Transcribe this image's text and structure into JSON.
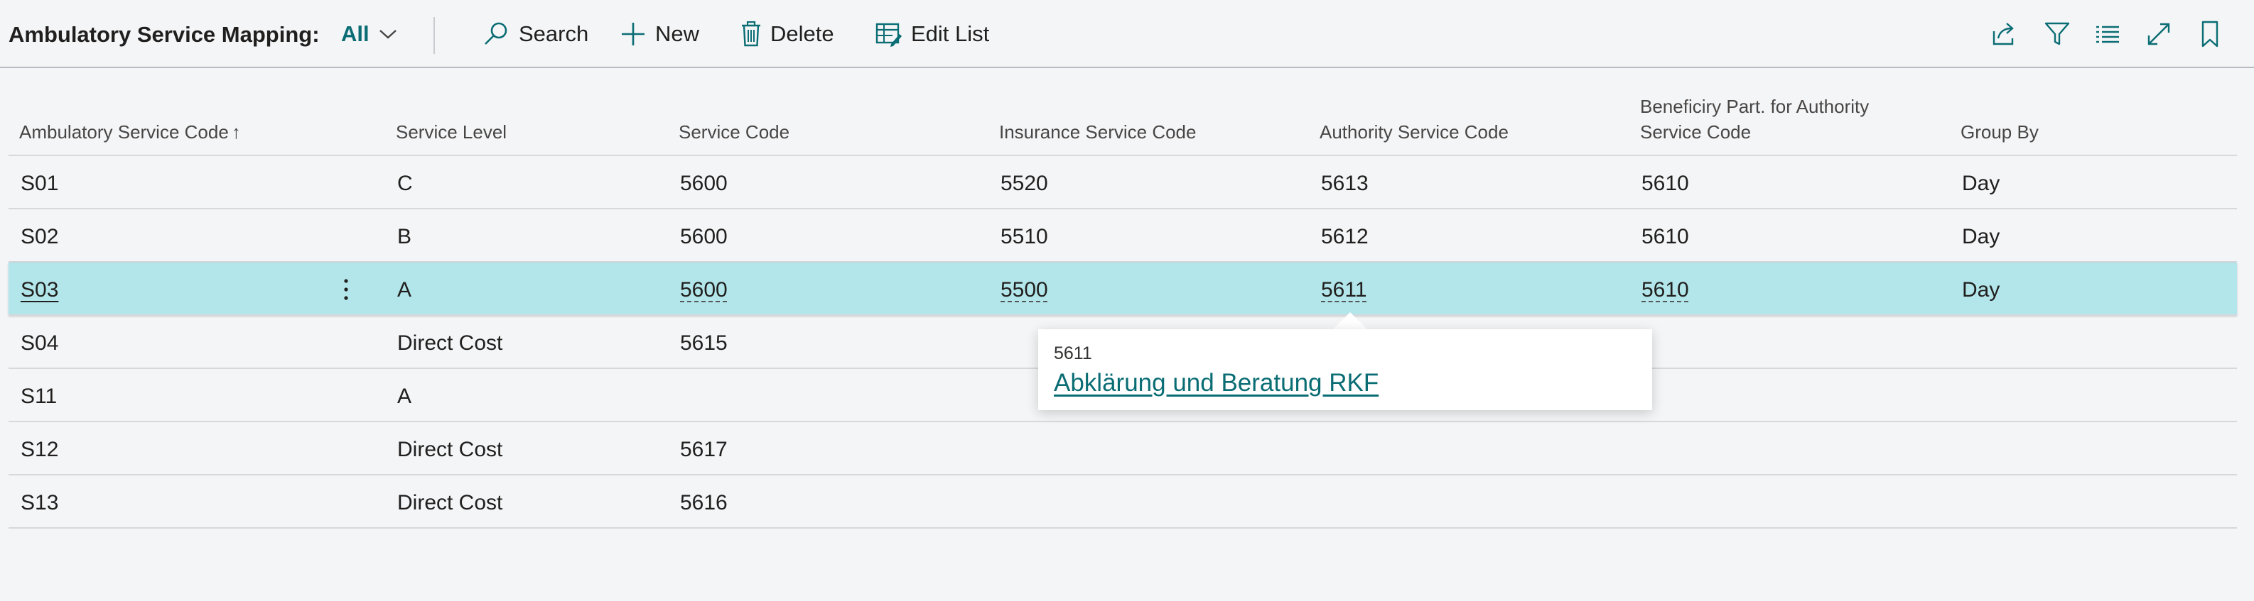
{
  "header": {
    "title": "Ambulatory Service Mapping:",
    "view": "All"
  },
  "actions": {
    "search": "Search",
    "new": "New",
    "delete": "Delete",
    "edit_list": "Edit List"
  },
  "toolbar_icons": [
    "share-icon",
    "filter-icon",
    "list-view-icon",
    "expand-icon",
    "bookmark-icon"
  ],
  "columns": {
    "ambulatory_service_code": "Ambulatory Service Code",
    "sort_indicator": "↑",
    "service_level": "Service Level",
    "service_code": "Service Code",
    "insurance_service_code": "Insurance Service Code",
    "authority_service_code": "Authority Service Code",
    "beneficiary_part_line1": "Beneficiry Part. for Authority",
    "beneficiary_part_line2": "Service Code",
    "group_by": "Group By"
  },
  "rows": [
    {
      "code": "S01",
      "level": "C",
      "service": "5600",
      "insurance": "5520",
      "authority": "5613",
      "beneficiary": "5610",
      "group": "Day"
    },
    {
      "code": "S02",
      "level": "B",
      "service": "5600",
      "insurance": "5510",
      "authority": "5612",
      "beneficiary": "5610",
      "group": "Day"
    },
    {
      "code": "S03",
      "level": "A",
      "service": "5600",
      "insurance": "5500",
      "authority": "5611",
      "beneficiary": "5610",
      "group": "Day"
    },
    {
      "code": "S04",
      "level": "Direct Cost",
      "service": "5615",
      "insurance": "",
      "authority": "",
      "beneficiary": "",
      "group": ""
    },
    {
      "code": "S11",
      "level": "A",
      "service": "",
      "insurance": "",
      "authority": "",
      "beneficiary": "",
      "group": ""
    },
    {
      "code": "S12",
      "level": "Direct Cost",
      "service": "5617",
      "insurance": "",
      "authority": "",
      "beneficiary": "",
      "group": ""
    },
    {
      "code": "S13",
      "level": "Direct Cost",
      "service": "5616",
      "insurance": "",
      "authority": "",
      "beneficiary": "",
      "group": ""
    }
  ],
  "selected_row_index": 2,
  "popup": {
    "code": "5611",
    "description": "Abklärung und Beratung RKF"
  },
  "colors": {
    "accent": "#0a6d74",
    "selected_row": "#b2e6ea",
    "background": "#f4f5f7"
  }
}
